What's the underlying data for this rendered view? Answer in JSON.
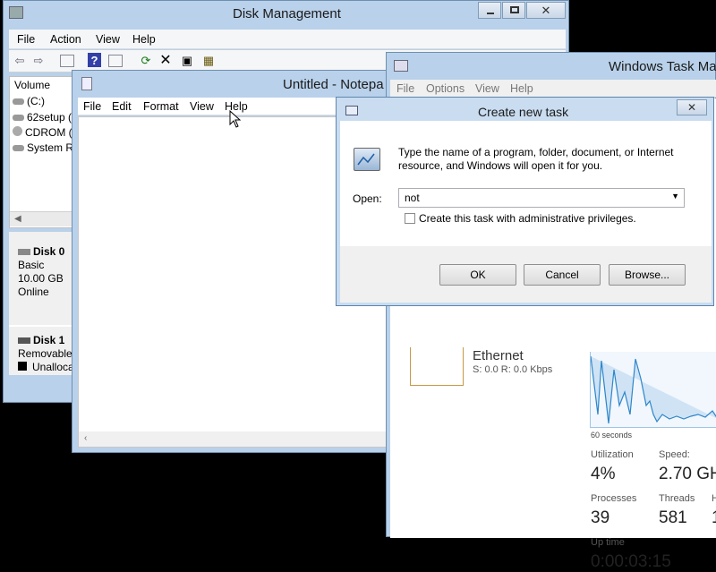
{
  "disk_mgmt": {
    "title": "Disk Management",
    "menu": [
      "File",
      "Action",
      "View",
      "Help"
    ],
    "volume_header": "Volume",
    "volumes": [
      "(C:)",
      "62setup (",
      "CDROM (",
      "System Re"
    ],
    "disk0": {
      "name": "Disk 0",
      "type": "Basic",
      "size": "10.00 GB",
      "status": "Online"
    },
    "disk1": {
      "name": "Disk 1",
      "type": "Removable",
      "partition": "Unallocat"
    }
  },
  "notepad": {
    "title": "Untitled - Notepa",
    "menu": [
      "File",
      "Edit",
      "Format",
      "View",
      "Help"
    ]
  },
  "taskmgr": {
    "title": "Windows Task Man",
    "menu": [
      "File",
      "Options",
      "View",
      "Help"
    ],
    "ethernet_label": "Ethernet",
    "ethernet_stats": "S: 0.0 R: 0.0 Kbps",
    "graph_caption": "60 seconds",
    "utilization_label": "Utilization",
    "utilization_value": "4%",
    "speed_label": "Speed:",
    "speed_value": "2.70 GH",
    "processes_label": "Processes",
    "processes_value": "39",
    "threads_label": "Threads",
    "threads_value": "581",
    "handles_label": "H",
    "handles_value": "1",
    "uptime_label": "Up time",
    "uptime_value": "0:00:03:15"
  },
  "run_dialog": {
    "title": "Create new task",
    "description_line1": "Type the name of a program, folder, document, or Internet",
    "description_line2": "resource, and Windows will open it for you.",
    "open_label": "Open:",
    "open_value": "not",
    "admin_checkbox_label": "Create this task with administrative privileges.",
    "admin_checked": false,
    "ok_label": "OK",
    "cancel_label": "Cancel",
    "browse_label": "Browse..."
  }
}
